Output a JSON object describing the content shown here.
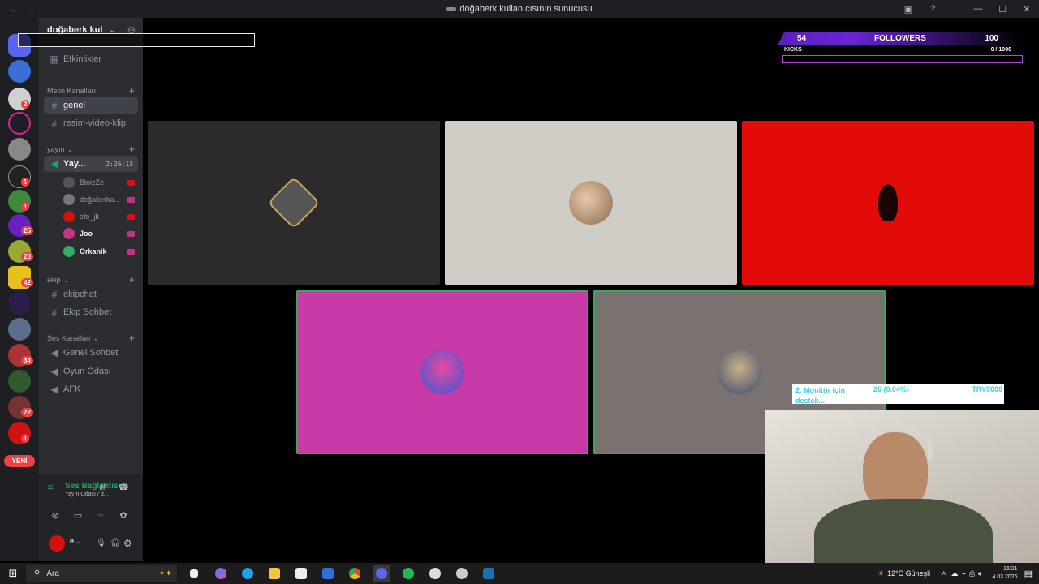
{
  "titlebar": {
    "title": "doğaberk kullanıcısının sunucusu",
    "back": "←",
    "forward": "→",
    "inbox_icon": "inbox-icon",
    "help_icon": "help-icon",
    "minimize": "—",
    "maximize": "☐",
    "close": "✕"
  },
  "rail": {
    "badges": [
      "2",
      "1",
      "1",
      "25",
      "20",
      "42",
      "34",
      "22",
      "1"
    ],
    "new_label": "YENİ"
  },
  "server": {
    "name": "doğaberk kul",
    "events_label": "Etkinlikler"
  },
  "overlay_box": {
    "text": "",
    "num": ""
  },
  "categories": {
    "text": "Metin Kanalları",
    "live": "yayın",
    "team": "ekip",
    "voice": "Ses Kanalları"
  },
  "channels": {
    "genel": "genel",
    "resim": "resim-video-klip",
    "live_room": "Yay...",
    "live_time": "2:26:13",
    "ekipchat": "ekipchat",
    "ekip_sohbet": "Ekip Sohbet",
    "genel_sohbet": "Genel Sohbet",
    "oyun": "Oyun Odası",
    "afk": "AFK"
  },
  "voice_users": [
    {
      "name": "BloizZe",
      "color": "#555"
    },
    {
      "name": "doğaberka...",
      "color": "#777"
    },
    {
      "name": "efe_jk",
      "color": "#d41111"
    },
    {
      "name": "Joo",
      "color": "#c13584"
    },
    {
      "name": "Orkanik",
      "color": "#3a6"
    }
  ],
  "voice_panel": {
    "status": "Ses Bağlantısı K",
    "sub": "Yayın Odası / d...",
    "user": "e..."
  },
  "followers": {
    "count": "54",
    "label": "FOLLOWERS",
    "goal": "100",
    "kicks_label": "KICKS",
    "kicks_value": "0  / 1000",
    "kicks_progress": 0
  },
  "donation": {
    "text": "2. Monitör için destek...",
    "amount": "26 (0.04%)",
    "goal": "TRY5000"
  },
  "taskbar": {
    "search_placeholder": "Ara",
    "weather": "12°C  Güneşli",
    "time": "16:21",
    "date": "4.03.2026"
  },
  "colors": {
    "tile1": "#2b2b2b",
    "tile2": "#cfcdc5",
    "tile3": "#e30a0a",
    "tile4": "#c83aa8",
    "tile5": "#7a7271",
    "accent": "#23a55a",
    "followers_bar": "#5b1fbf"
  }
}
